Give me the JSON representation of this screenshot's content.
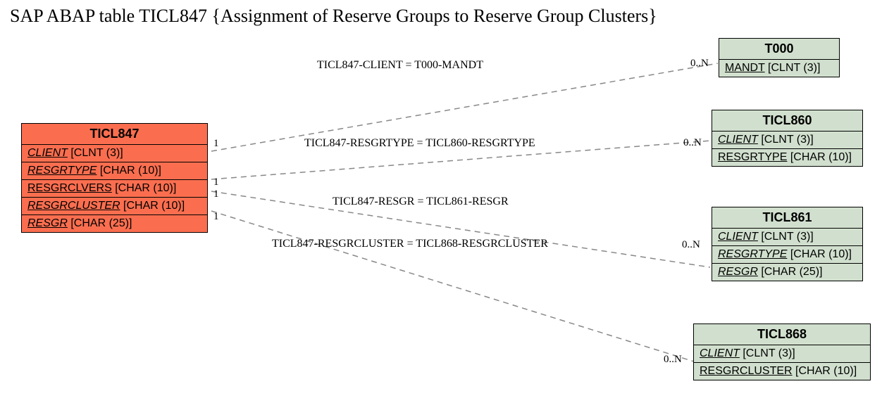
{
  "title": "SAP ABAP table TICL847 {Assignment of Reserve Groups to Reserve Group Clusters}",
  "main_entity": {
    "name": "TICL847",
    "fields": [
      {
        "label": "CLIENT",
        "type": "[CLNT (3)]",
        "italic": true,
        "underline": true
      },
      {
        "label": "RESGRTYPE",
        "type": "[CHAR (10)]",
        "italic": true,
        "underline": true
      },
      {
        "label": "RESGRCLVERS",
        "type": "[CHAR (10)]",
        "italic": false,
        "underline": true
      },
      {
        "label": "RESGRCLUSTER",
        "type": "[CHAR (10)]",
        "italic": true,
        "underline": true
      },
      {
        "label": "RESGR",
        "type": "[CHAR (25)]",
        "italic": true,
        "underline": true
      }
    ]
  },
  "ref_entities": [
    {
      "name": "T000",
      "fields": [
        {
          "label": "MANDT",
          "type": "[CLNT (3)]",
          "italic": false,
          "underline": true
        }
      ]
    },
    {
      "name": "TICL860",
      "fields": [
        {
          "label": "CLIENT",
          "type": "[CLNT (3)]",
          "italic": true,
          "underline": true
        },
        {
          "label": "RESGRTYPE",
          "type": "[CHAR (10)]",
          "italic": false,
          "underline": true
        }
      ]
    },
    {
      "name": "TICL861",
      "fields": [
        {
          "label": "CLIENT",
          "type": "[CLNT (3)]",
          "italic": true,
          "underline": true
        },
        {
          "label": "RESGRTYPE",
          "type": "[CHAR (10)]",
          "italic": true,
          "underline": true
        },
        {
          "label": "RESGR",
          "type": "[CHAR (25)]",
          "italic": true,
          "underline": true
        }
      ]
    },
    {
      "name": "TICL868",
      "fields": [
        {
          "label": "CLIENT",
          "type": "[CLNT (3)]",
          "italic": true,
          "underline": true
        },
        {
          "label": "RESGRCLUSTER",
          "type": "[CHAR (10)]",
          "italic": false,
          "underline": true
        }
      ]
    }
  ],
  "relations": [
    {
      "label": "TICL847-CLIENT = T000-MANDT",
      "left_card": "1",
      "right_card": "0..N"
    },
    {
      "label": "TICL847-RESGRTYPE = TICL860-RESGRTYPE",
      "left_card": "1",
      "right_card": "0..N"
    },
    {
      "label": "TICL847-RESGR = TICL861-RESGR",
      "left_card": "1",
      "right_card": "0..N"
    },
    {
      "label": "TICL847-RESGRCLUSTER = TICL868-RESGRCLUSTER",
      "left_card": "1",
      "right_card": "0..N"
    }
  ]
}
